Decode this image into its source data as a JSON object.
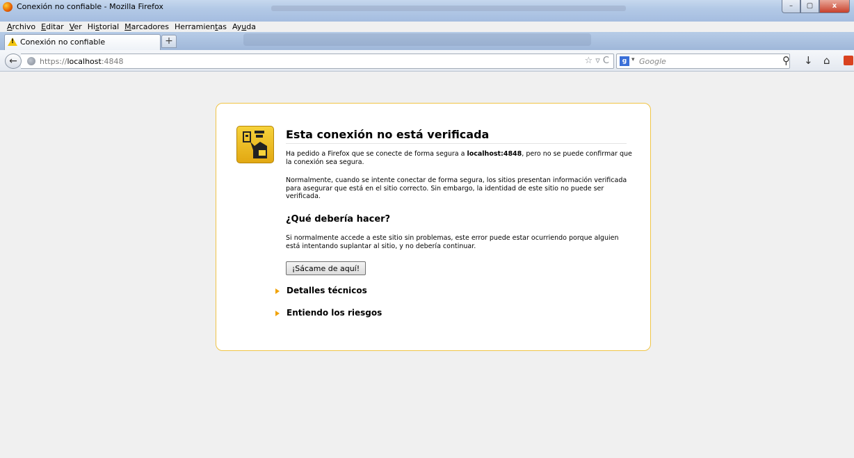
{
  "window": {
    "title": "Conexión no confiable - Mozilla Firefox",
    "buttons": {
      "minimize": "–",
      "maximize": "▢",
      "close": "x"
    }
  },
  "menu": [
    "Archivo",
    "Editar",
    "Ver",
    "Historial",
    "Marcadores",
    "Herramientas",
    "Ayuda"
  ],
  "menu_underline_index": [
    0,
    0,
    0,
    2,
    0,
    9,
    2
  ],
  "tab": {
    "label": "Conexión no confiable",
    "new_tab": "+"
  },
  "nav": {
    "back": "←",
    "url_prefix": "https://",
    "url_host": "localhost",
    "url_suffix": ":4848",
    "url_icons": "☆ ▿ C",
    "search_engine": "g",
    "search_placeholder": "Google",
    "search_icon": "⚲",
    "download_icon": "↓",
    "home_icon": "⌂"
  },
  "error": {
    "title": "Esta conexión no está verificada",
    "p1_pre": "Ha pedido a Firefox que se conecte de forma segura a ",
    "p1_host": "localhost:4848",
    "p1_post": ", pero no se puede confirmar que la conexión sea segura.",
    "p2": "Normalmente, cuando se intente conectar de forma segura, los sitios presentan información verificada para asegurar que está en el sitio correcto. Sin embargo, la identidad de este sitio no puede ser verificada.",
    "what_heading": "¿Qué debería hacer?",
    "p3": "Si normalmente accede a este sitio sin problemas, este error puede estar ocurriendo porque alguien está intentando suplantar al sitio, y no debería continuar.",
    "get_out_button": "¡Sácame de aquí!",
    "technical_details": "Detalles técnicos",
    "understand_risks": "Entiendo los riesgos"
  },
  "colors": {
    "accent_border": "#f0c445",
    "expander_arrow": "#f0a30a"
  }
}
